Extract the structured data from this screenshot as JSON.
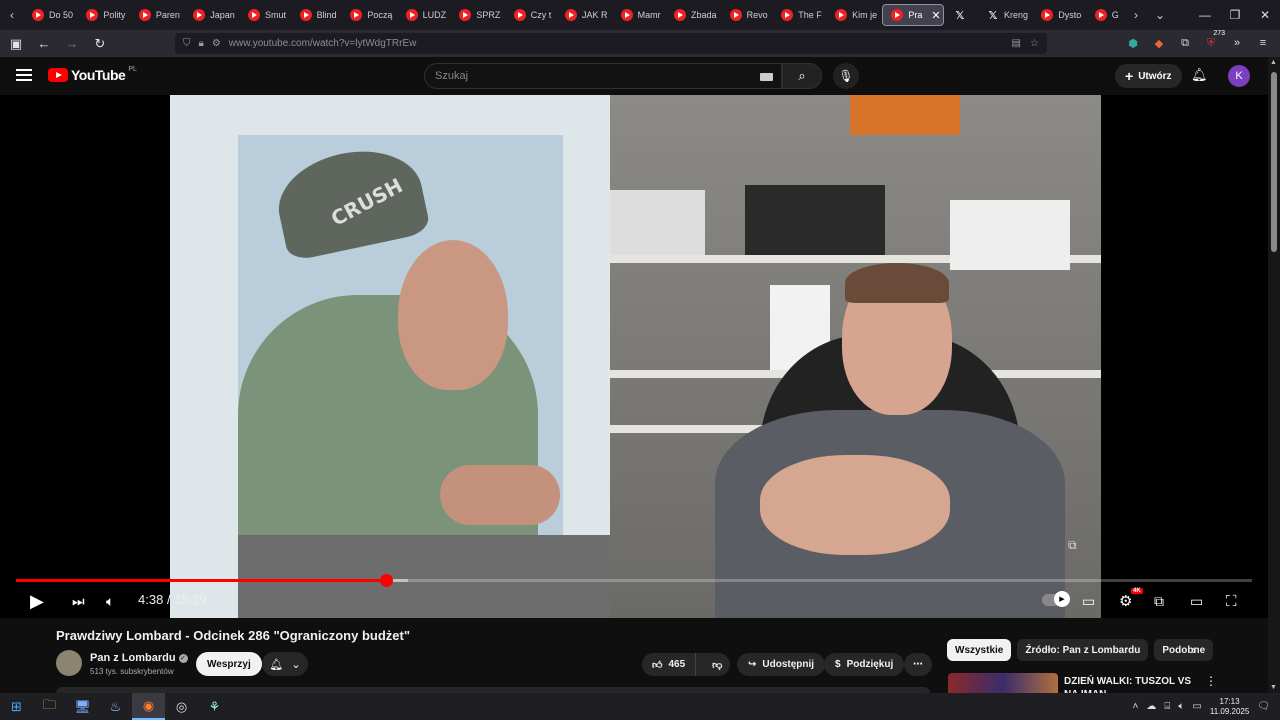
{
  "browser": {
    "tabs": [
      {
        "label": "Do 50",
        "icon": "youtube-icon"
      },
      {
        "label": "Polity",
        "icon": "youtube-icon"
      },
      {
        "label": "Paren",
        "icon": "youtube-icon"
      },
      {
        "label": "Japan",
        "icon": "youtube-icon"
      },
      {
        "label": "Smut",
        "icon": "youtube-icon"
      },
      {
        "label": "Blind",
        "icon": "youtube-icon"
      },
      {
        "label": "Począ",
        "icon": "youtube-icon"
      },
      {
        "label": "LUDZ",
        "icon": "youtube-icon"
      },
      {
        "label": "SPRZ",
        "icon": "youtube-icon"
      },
      {
        "label": "Czy t",
        "icon": "youtube-icon"
      },
      {
        "label": "JAK R",
        "icon": "youtube-icon"
      },
      {
        "label": "Mamr",
        "icon": "youtube-icon"
      },
      {
        "label": "Zbada",
        "icon": "youtube-icon"
      },
      {
        "label": "Revo",
        "icon": "youtube-icon"
      },
      {
        "label": "The F",
        "icon": "youtube-icon"
      },
      {
        "label": "Kim je",
        "icon": "youtube-icon"
      },
      {
        "label": "Pra",
        "icon": "youtube-icon",
        "active": true
      },
      {
        "label": "",
        "icon": "x-icon"
      },
      {
        "label": "Kreng",
        "icon": "x-icon"
      },
      {
        "label": "Dysto",
        "icon": "youtube-icon"
      },
      {
        "label": "G",
        "icon": "youtube-icon"
      }
    ],
    "tab_close": "✕",
    "url": "www.youtube.com/watch?v=lytWdgTRrEw",
    "extension_badge": "273"
  },
  "youtube": {
    "logo_text": "YouTube",
    "region": "PL",
    "search_placeholder": "Szukaj",
    "create_label": "Utwórz",
    "avatar_letter": "K"
  },
  "player": {
    "current_time": "4:38",
    "separator": "/",
    "duration": "15:29",
    "played_fraction": 0.299,
    "buffered_fraction": 0.317,
    "quality_badge": "4K",
    "cap_text": "CRUSH"
  },
  "video_info": {
    "title": "Prawdziwy Lombard - Odcinek 286 \"Ograniczony budżet\"",
    "channel_name": "Pan z Lombardu",
    "subscribers": "513 tys. subskrybentów",
    "support_label": "Wesprzyj",
    "likes": "465",
    "share_label": "Udostępnij",
    "thanks_label": "Podziękuj"
  },
  "sidebar": {
    "chips": [
      {
        "label": "Wszystkie",
        "active": true
      },
      {
        "label": "Źródło: Pan z Lombardu",
        "active": false
      },
      {
        "label": "Podobne",
        "active": false
      }
    ],
    "recommendation_title": "DZIEŃ WALKI: TUSZOL VS NA IMAN"
  },
  "taskbar": {
    "time": "17:13",
    "date": "11.09.2025"
  },
  "colors": {
    "accent_red": "#ff0000",
    "background": "#0f0f0f",
    "avatar": "#7b3fbf"
  }
}
